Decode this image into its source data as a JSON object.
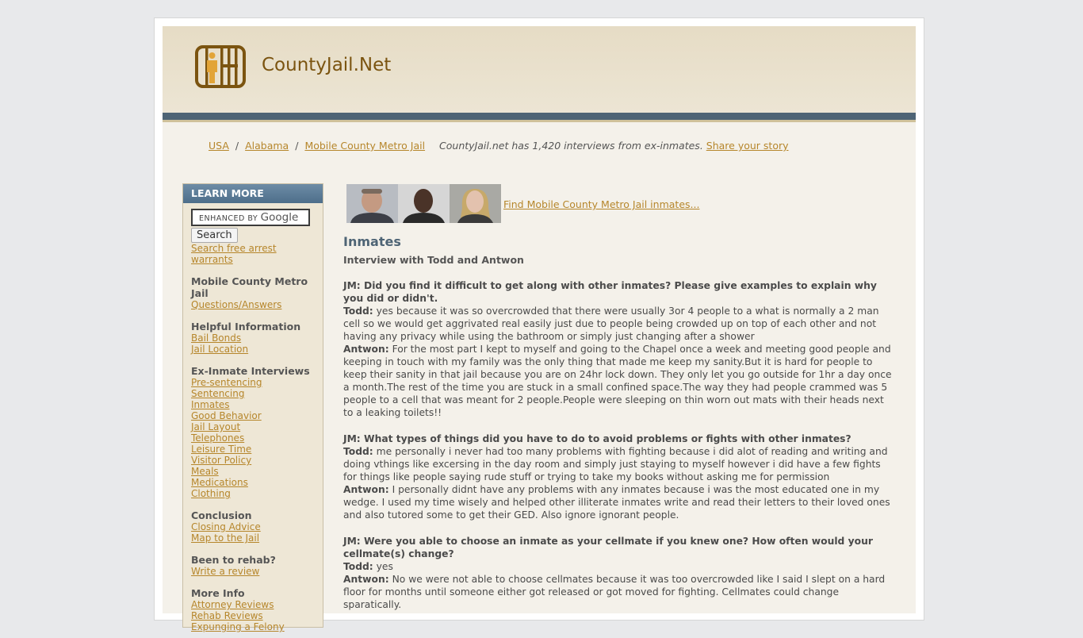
{
  "site": {
    "title": "CountyJail.Net"
  },
  "breadcrumb": {
    "items": [
      "USA",
      "Alabama",
      "Mobile County Metro Jail"
    ],
    "note": "CountyJail.net has 1,420 interviews from ex-inmates.",
    "share_link": "Share your story"
  },
  "sidebar": {
    "header": "LEARN MORE",
    "search": {
      "enhanced_by": "ENHANCED BY",
      "google": "Google",
      "button": "Search"
    },
    "warrants_link": "Search free arrest warrants",
    "sections": [
      {
        "title": "Mobile County Metro Jail",
        "links": [
          "Questions/Answers"
        ]
      },
      {
        "title": "Helpful Information",
        "links": [
          "Bail Bonds",
          "Jail Location"
        ]
      },
      {
        "title": "Ex-Inmate Interviews",
        "links": [
          "Pre-sentencing",
          "Sentencing",
          "Inmates",
          "Good Behavior",
          "Jail Layout",
          "Telephones",
          "Leisure Time",
          "Visitor Policy",
          "Meals",
          "Medications",
          "Clothing"
        ]
      },
      {
        "title": "Conclusion",
        "links": [
          "Closing Advice",
          "Map to the Jail"
        ]
      },
      {
        "title": "Been to rehab?",
        "links": [
          "Write a review"
        ]
      },
      {
        "title": "More Info",
        "links": [
          "Attorney Reviews",
          "Rehab Reviews",
          "Expunging a Felony"
        ]
      }
    ]
  },
  "main": {
    "find_link": "Find Mobile County Metro Jail inmates...",
    "heading": "Inmates",
    "subheading": "Interview with Todd and Antwon",
    "qa": [
      {
        "q": "JM: Did you find it difficult to get along with other inmates? Please give examples to explain why you did or didn't.",
        "a1_who": "Todd:",
        "a1": "yes because it was so overcrowded that there were usually 3or 4 people to a what is normally a 2 man cell so we would get aggrivated real easily just due to people being crowded up on top of each other and not having any privacy while using the bathroom or simply just changing after a shower",
        "a2_who": "Antwon:",
        "a2": "For the most part I kept to myself and going to the Chapel once a week and meeting good people and keeping in touch with my family was the only thing that made me keep my sanity.But it is hard for people to keep their sanity in that jail because you are on 24hr lock down. They only let you go outside for 1hr a day once a month.The rest of the time you are stuck in a small confined space.The way they had people crammed was 5 people to a cell that was meant for 2 people.People were sleeping on thin worn out mats with their heads next to a leaking toilets!!"
      },
      {
        "q": "JM: What types of things did you have to do to avoid problems or fights with other inmates?",
        "a1_who": "Todd:",
        "a1": "me personally i never had too many problems with fighting because i did alot of reading and writing and doing vthings like excersing in the day room and simply just staying to myself however i did have a few fights for things like people saying rude stuff or trying to take my books without asking me for permission",
        "a2_who": "Antwon:",
        "a2": "I personally didnt have any problems with any inmates because i was the most educated one in my wedge. I used my time wisely and helped other illiterate inmates write and read their letters to their loved ones and also tutored some to get their GED. Also ignore ignorant people."
      },
      {
        "q": "JM: Were you able to choose an inmate as your cellmate if you knew one? How often would your cellmate(s) change?",
        "a1_who": "Todd:",
        "a1": "yes",
        "a2_who": "Antwon:",
        "a2": "No we were not able to choose cellmates because it was too overcrowded like I said I slept on a hard floor for months until someone either got released or got moved for fighting. Cellmates could change sparatically."
      }
    ]
  }
}
